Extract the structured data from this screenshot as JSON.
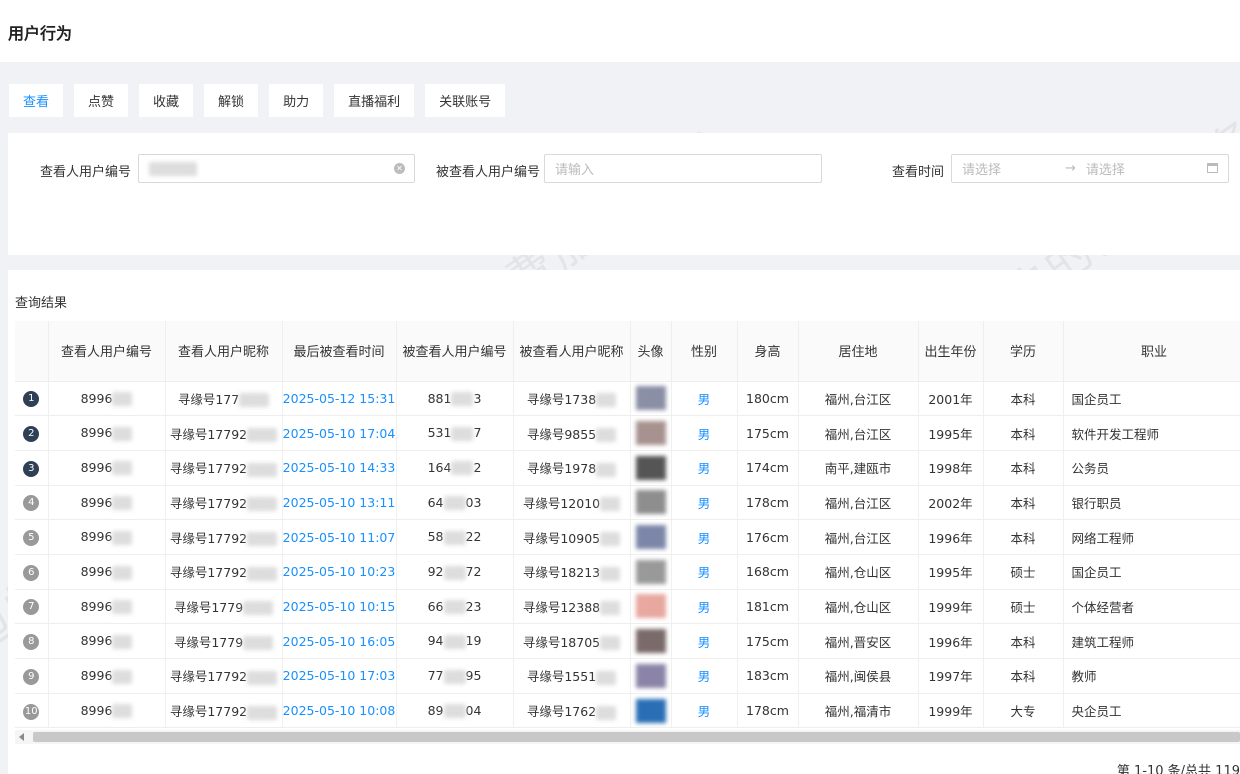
{
  "page_title": "用户行为",
  "tabs": [
    "查看",
    "点赞",
    "收藏",
    "解锁",
    "助力",
    "直播福利",
    "关联账号"
  ],
  "active_tab": 0,
  "filters": {
    "viewer_id_label": "查看人用户编号",
    "viewed_id_label": "被查看人用户编号",
    "viewed_id_placeholder": "请输入",
    "time_label": "查看时间",
    "start_placeholder": "请选择",
    "end_placeholder": "请选择",
    "range_separator": "→"
  },
  "results_title": "查询结果",
  "columns": [
    "查看人用户编号",
    "查看人用户昵称",
    "最后被查看时间",
    "被查看人用户编号",
    "被查看人用户昵称",
    "头像",
    "性别",
    "身高",
    "居住地",
    "出生年份",
    "学历",
    "职业"
  ],
  "rows": [
    {
      "idx": "1",
      "viewer_id": "8996",
      "viewer_nick": "寻缘号177",
      "time": "2025-05-12 15:31",
      "viewed_id_a": "881",
      "viewed_id_b": "3",
      "viewed_nick": "寻缘号1738",
      "gender": "男",
      "height": "180cm",
      "residence": "福州,台江区",
      "birth": "2001年",
      "edu": "本科",
      "job": "国企员工"
    },
    {
      "idx": "2",
      "viewer_id": "8996",
      "viewer_nick": "寻缘号17792",
      "time": "2025-05-10 17:04",
      "viewed_id_a": "531",
      "viewed_id_b": "7",
      "viewed_nick": "寻缘号9855",
      "gender": "男",
      "height": "175cm",
      "residence": "福州,台江区",
      "birth": "1995年",
      "edu": "本科",
      "job": "软件开发工程师"
    },
    {
      "idx": "3",
      "viewer_id": "8996",
      "viewer_nick": "寻缘号17792",
      "time": "2025-05-10 14:33",
      "viewed_id_a": "164",
      "viewed_id_b": "2",
      "viewed_nick": "寻缘号1978",
      "gender": "男",
      "height": "174cm",
      "residence": "南平,建瓯市",
      "birth": "1998年",
      "edu": "本科",
      "job": "公务员"
    },
    {
      "idx": "4",
      "viewer_id": "8996",
      "viewer_nick": "寻缘号17792",
      "time": "2025-05-10 13:11",
      "viewed_id_a": "64",
      "viewed_id_b": "03",
      "viewed_nick": "寻缘号12010",
      "gender": "男",
      "height": "178cm",
      "residence": "福州,台江区",
      "birth": "2002年",
      "edu": "本科",
      "job": "银行职员"
    },
    {
      "idx": "5",
      "viewer_id": "8996",
      "viewer_nick": "寻缘号17792",
      "time": "2025-05-10 11:07",
      "viewed_id_a": "58",
      "viewed_id_b": "22",
      "viewed_nick": "寻缘号10905",
      "gender": "男",
      "height": "176cm",
      "residence": "福州,台江区",
      "birth": "1996年",
      "edu": "本科",
      "job": "网络工程师"
    },
    {
      "idx": "6",
      "viewer_id": "8996",
      "viewer_nick": "寻缘号17792",
      "time": "2025-05-10 10:23",
      "viewed_id_a": "92",
      "viewed_id_b": "72",
      "viewed_nick": "寻缘号18213",
      "gender": "男",
      "height": "168cm",
      "residence": "福州,仓山区",
      "birth": "1995年",
      "edu": "硕士",
      "job": "国企员工"
    },
    {
      "idx": "7",
      "viewer_id": "8996",
      "viewer_nick": "寻缘号1779",
      "time": "2025-05-10 10:15",
      "viewed_id_a": "66",
      "viewed_id_b": "23",
      "viewed_nick": "寻缘号12388",
      "gender": "男",
      "height": "181cm",
      "residence": "福州,仓山区",
      "birth": "1999年",
      "edu": "硕士",
      "job": "个体经营者"
    },
    {
      "idx": "8",
      "viewer_id": "8996",
      "viewer_nick": "寻缘号1779",
      "time": "2025-05-10 16:05",
      "viewed_id_a": "94",
      "viewed_id_b": "19",
      "viewed_nick": "寻缘号18705",
      "gender": "男",
      "height": "175cm",
      "residence": "福州,晋安区",
      "birth": "1996年",
      "edu": "本科",
      "job": "建筑工程师"
    },
    {
      "idx": "9",
      "viewer_id": "8996",
      "viewer_nick": "寻缘号17792",
      "time": "2025-05-10 17:03",
      "viewed_id_a": "77",
      "viewed_id_b": "95",
      "viewed_nick": "寻缘号1551",
      "gender": "男",
      "height": "183cm",
      "residence": "福州,闽侯县",
      "birth": "1997年",
      "edu": "本科",
      "job": "教师"
    },
    {
      "idx": "10",
      "viewer_id": "8996",
      "viewer_nick": "寻缘号17792",
      "time": "2025-05-10 10:08",
      "viewed_id_a": "89",
      "viewed_id_b": "04",
      "viewed_nick": "寻缘号1762",
      "gender": "男",
      "height": "178cm",
      "residence": "福州,福清市",
      "birth": "1999年",
      "edu": "大专",
      "job": "央企员工"
    }
  ],
  "pagination": "第 1-10 条/总共 119",
  "watermark": "您身边的消费服务管家",
  "colors": {
    "accent": "#1890ff",
    "index_dark": "#2f3f56",
    "index_gray": "#999999"
  }
}
